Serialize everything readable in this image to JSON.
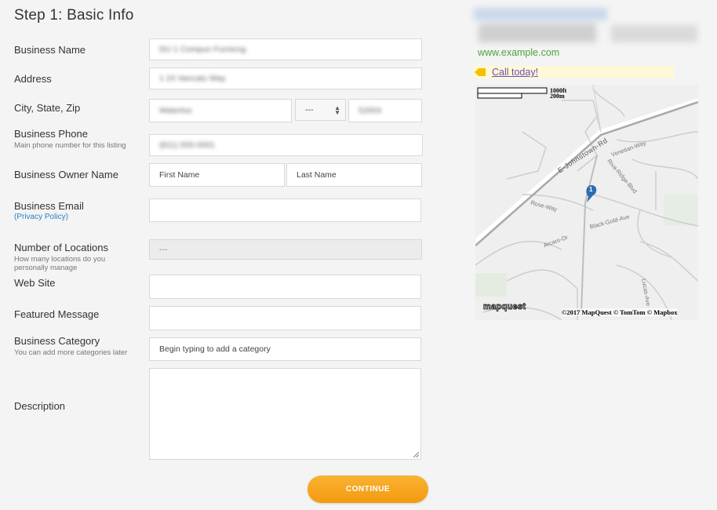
{
  "form": {
    "title": "Step 1: Basic Info",
    "business_name": {
      "label": "Business Name",
      "value": "DU 1 Compun Furnicng"
    },
    "address": {
      "label": "Address",
      "value": "1 24 Vancatu Way"
    },
    "city_state_zip": {
      "label": "City, State, Zip",
      "city": "Waterloo",
      "state": "---",
      "zip": "52004"
    },
    "phone": {
      "label": "Business Phone",
      "sublabel": "Main phone number for this listing",
      "value": "(811) 555-0001"
    },
    "owner": {
      "label": "Business Owner Name",
      "first_placeholder": "First Name",
      "last_placeholder": "Last Name"
    },
    "email": {
      "label": "Business Email",
      "privacy_link": "(Privacy Policy)",
      "value": ""
    },
    "locations": {
      "label": "Number of Locations",
      "sublabel": "How many locations do you personally manage",
      "value": "---"
    },
    "website": {
      "label": "Web Site",
      "value": ""
    },
    "featured": {
      "label": "Featured Message",
      "value": ""
    },
    "category": {
      "label": "Business Category",
      "sublabel": "You can add more categories later",
      "placeholder": "Begin typing to add a category"
    },
    "description": {
      "label": "Description",
      "value": ""
    },
    "continue_label": "CONTINUE"
  },
  "preview": {
    "url": "www.example.com",
    "call_link": "Call today!",
    "map": {
      "scale_ft": "1000ft",
      "scale_m": "200m",
      "brand": "mapquest",
      "attribution": "©2017 MapQuest © TomTom © Mapbox",
      "marker_label": "1",
      "streets": [
        "E-Johnstown-Rd",
        "Venetian-Way",
        "Riva-Ridge-Blvd",
        "Rose-Way",
        "Black-Gold-Ave",
        "Arcaro-Dr",
        "Lucas-Ave"
      ]
    }
  },
  "colors": {
    "accent_orange": "#f5a623",
    "url_green": "#4aa33a",
    "link_blue": "#2a7fc5"
  }
}
